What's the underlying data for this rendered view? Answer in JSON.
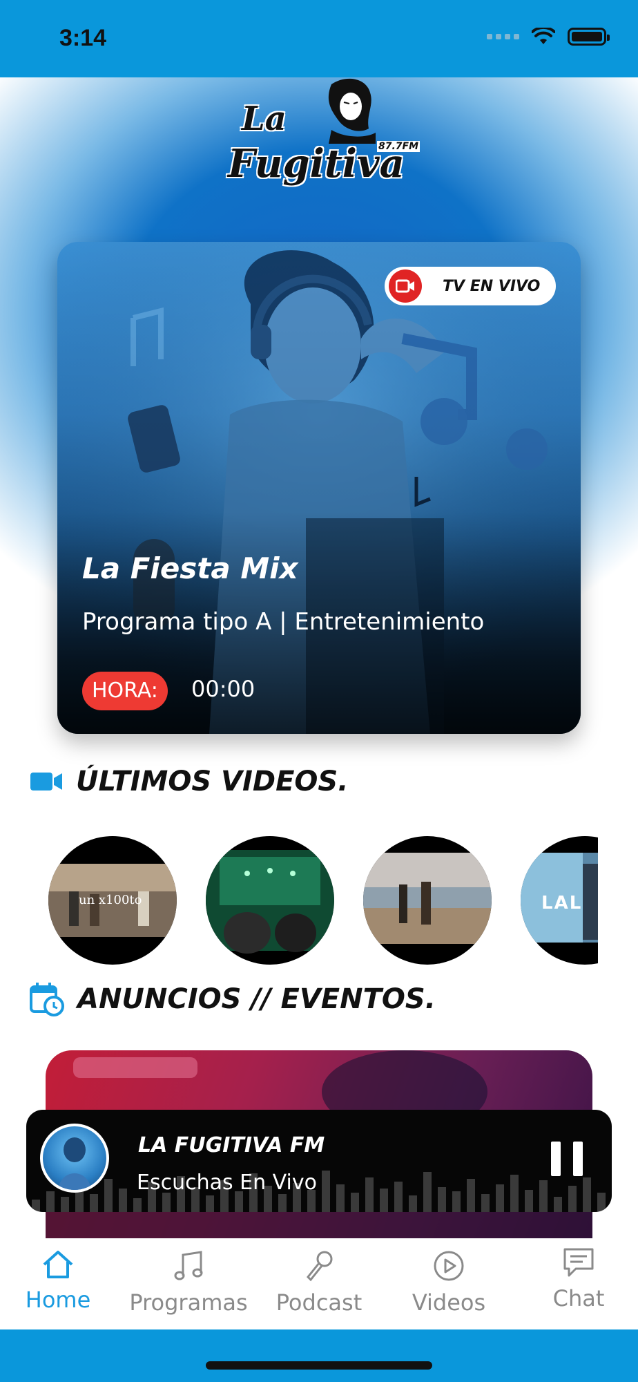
{
  "status_bar": {
    "time": "3:14"
  },
  "header": {
    "logo_line1": "La",
    "logo_line2": "Fugitiva",
    "logo_frequency": "87.7FM"
  },
  "live_card": {
    "badge_label": "TV EN VIVO",
    "title": "La Fiesta Mix",
    "subtitle": "Programa tipo A | Entretenimiento",
    "hora_label": "HORA:",
    "hora_value": "00:00"
  },
  "videos_section": {
    "title": "ÚLTIMOS VIDEOS.",
    "thumbnails": [
      {
        "caption": "un x100to"
      },
      {
        "caption": ""
      },
      {
        "caption": ""
      },
      {
        "caption": "LAL"
      }
    ]
  },
  "anuncios_section": {
    "title": "ANUNCIOS // EVENTOS."
  },
  "player": {
    "title": "LA FUGITIVA FM",
    "subtitle": "Escuchas En Vivo"
  },
  "bottom_nav": {
    "items": [
      {
        "label": "Home",
        "icon": "home-icon",
        "active": true
      },
      {
        "label": "Programas",
        "icon": "music-note-icon",
        "active": false
      },
      {
        "label": "Podcast",
        "icon": "microphone-icon",
        "active": false
      },
      {
        "label": "Videos",
        "icon": "play-circle-icon",
        "active": false
      },
      {
        "label": "Chat",
        "icon": "chat-icon",
        "active": false
      }
    ]
  },
  "colors": {
    "brand_blue": "#0a97db",
    "live_red": "#e02424",
    "hora_red": "#ee3a33",
    "active_nav": "#1a9be0"
  }
}
